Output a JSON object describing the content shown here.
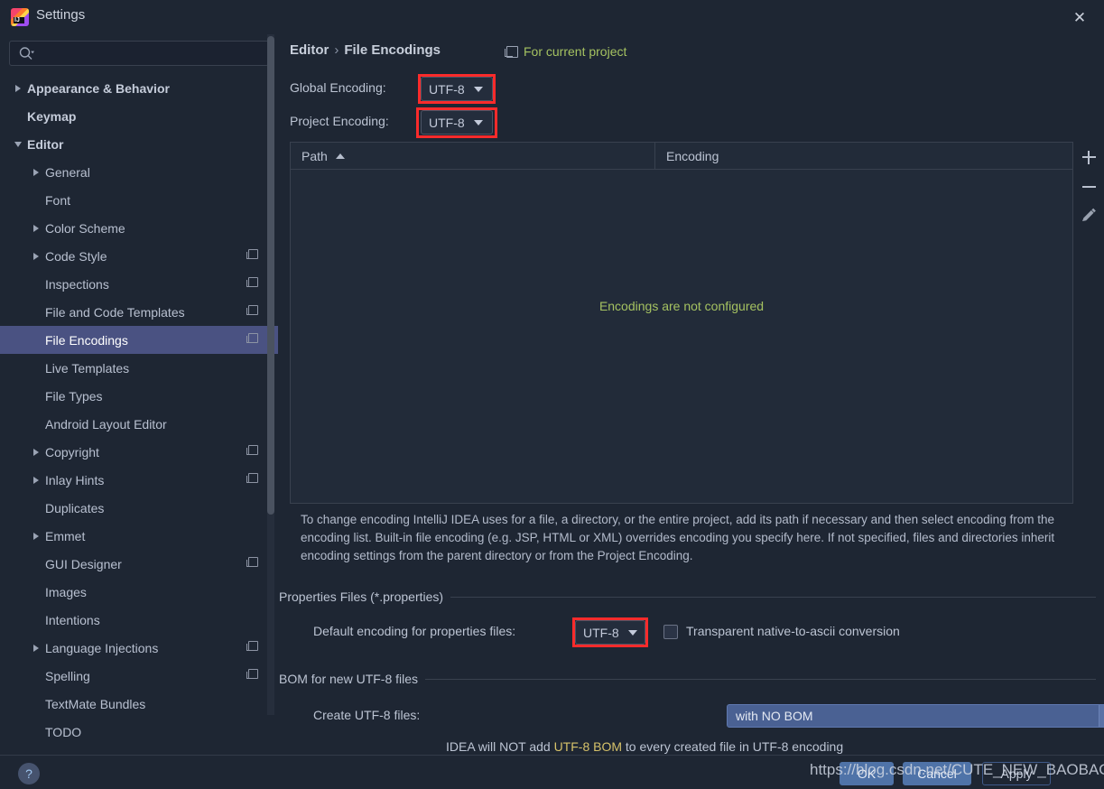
{
  "window": {
    "title": "Settings",
    "logo_text": "IJ",
    "close_label": "✕"
  },
  "sidebar": {
    "search": {
      "value": "",
      "placeholder": ""
    },
    "items": [
      {
        "label": "Appearance & Behavior",
        "indent": 0,
        "arrow": "right",
        "bold": true,
        "badge": false,
        "selected": false
      },
      {
        "label": "Keymap",
        "indent": 0,
        "arrow": "none",
        "bold": true,
        "badge": false,
        "selected": false
      },
      {
        "label": "Editor",
        "indent": 0,
        "arrow": "down",
        "bold": true,
        "badge": false,
        "selected": false
      },
      {
        "label": "General",
        "indent": 1,
        "arrow": "right",
        "bold": false,
        "badge": false,
        "selected": false
      },
      {
        "label": "Font",
        "indent": 1,
        "arrow": "none",
        "bold": false,
        "badge": false,
        "selected": false
      },
      {
        "label": "Color Scheme",
        "indent": 1,
        "arrow": "right",
        "bold": false,
        "badge": false,
        "selected": false
      },
      {
        "label": "Code Style",
        "indent": 1,
        "arrow": "right",
        "bold": false,
        "badge": true,
        "selected": false
      },
      {
        "label": "Inspections",
        "indent": 1,
        "arrow": "none",
        "bold": false,
        "badge": true,
        "selected": false
      },
      {
        "label": "File and Code Templates",
        "indent": 1,
        "arrow": "none",
        "bold": false,
        "badge": true,
        "selected": false
      },
      {
        "label": "File Encodings",
        "indent": 1,
        "arrow": "none",
        "bold": false,
        "badge": true,
        "selected": true
      },
      {
        "label": "Live Templates",
        "indent": 1,
        "arrow": "none",
        "bold": false,
        "badge": false,
        "selected": false
      },
      {
        "label": "File Types",
        "indent": 1,
        "arrow": "none",
        "bold": false,
        "badge": false,
        "selected": false
      },
      {
        "label": "Android Layout Editor",
        "indent": 1,
        "arrow": "none",
        "bold": false,
        "badge": false,
        "selected": false
      },
      {
        "label": "Copyright",
        "indent": 1,
        "arrow": "right",
        "bold": false,
        "badge": true,
        "selected": false
      },
      {
        "label": "Inlay Hints",
        "indent": 1,
        "arrow": "right",
        "bold": false,
        "badge": true,
        "selected": false
      },
      {
        "label": "Duplicates",
        "indent": 1,
        "arrow": "none",
        "bold": false,
        "badge": false,
        "selected": false
      },
      {
        "label": "Emmet",
        "indent": 1,
        "arrow": "right",
        "bold": false,
        "badge": false,
        "selected": false
      },
      {
        "label": "GUI Designer",
        "indent": 1,
        "arrow": "none",
        "bold": false,
        "badge": true,
        "selected": false
      },
      {
        "label": "Images",
        "indent": 1,
        "arrow": "none",
        "bold": false,
        "badge": false,
        "selected": false
      },
      {
        "label": "Intentions",
        "indent": 1,
        "arrow": "none",
        "bold": false,
        "badge": false,
        "selected": false
      },
      {
        "label": "Language Injections",
        "indent": 1,
        "arrow": "right",
        "bold": false,
        "badge": true,
        "selected": false
      },
      {
        "label": "Spelling",
        "indent": 1,
        "arrow": "none",
        "bold": false,
        "badge": true,
        "selected": false
      },
      {
        "label": "TextMate Bundles",
        "indent": 1,
        "arrow": "none",
        "bold": false,
        "badge": false,
        "selected": false
      },
      {
        "label": "TODO",
        "indent": 1,
        "arrow": "none",
        "bold": false,
        "badge": false,
        "selected": false
      }
    ]
  },
  "main": {
    "breadcrumb": {
      "parent": "Editor",
      "separator": "›",
      "current": "File Encodings"
    },
    "project_scope_label": "For current project",
    "global_encoding": {
      "label": "Global Encoding:",
      "value": "UTF-8"
    },
    "project_encoding": {
      "label": "Project Encoding:",
      "value": "UTF-8"
    },
    "table": {
      "columns": [
        "Path",
        "Encoding"
      ],
      "sort_column": "Path",
      "sort_direction": "asc",
      "rows": [],
      "empty_message": "Encodings are not configured"
    },
    "table_tools": [
      "add-icon",
      "remove-icon",
      "edit-icon"
    ],
    "description": "To change encoding IntelliJ IDEA uses for a file, a directory, or the entire project, add its path if necessary and then select encoding from the encoding list. Built-in file encoding (e.g. JSP, HTML or XML) overrides encoding you specify here. If not specified, files and directories inherit encoding settings from the parent directory or from the Project Encoding.",
    "properties_section": {
      "title": "Properties Files (*.properties)",
      "default_encoding_label": "Default encoding for properties files:",
      "default_encoding_value": "UTF-8",
      "transparent_label": "Transparent native-to-ascii conversion",
      "transparent_checked": false
    },
    "bom_section": {
      "title": "BOM for new UTF-8 files",
      "create_label": "Create UTF-8 files:",
      "create_value": "with NO BOM",
      "hint_prefix": "IDEA will NOT add ",
      "hint_highlight": "UTF-8 BOM",
      "hint_suffix": " to every created file in UTF-8 encoding"
    }
  },
  "footer": {
    "help_label": "?",
    "ok_label": "OK",
    "cancel_label": "Cancel",
    "apply_label": "Apply",
    "watermark": "https://blog.csdn.net/CUTE_NEW_BAOBAO"
  },
  "colors": {
    "accent_selection": "#4a5282",
    "green_text": "#a5c261",
    "annotation_red": "#fb2b2b",
    "combo_focus_blue": "#4a6193",
    "bom_highlight": "#d6c26a"
  }
}
